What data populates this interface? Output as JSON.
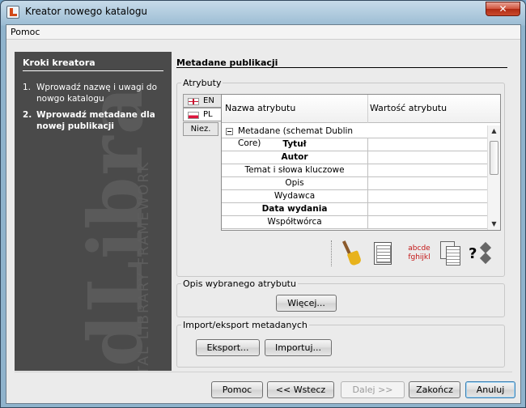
{
  "window": {
    "title": "Kreator nowego katalogu",
    "close_label": "✕"
  },
  "menu": {
    "items": [
      "Pomoc"
    ]
  },
  "steps": {
    "title": "Kroki kreatora",
    "items": [
      {
        "num": "1.",
        "label": "Wprowadź nazwę i uwagi do nowgo katalogu",
        "current": false
      },
      {
        "num": "2.",
        "label": "Wprowadź metadane dla nowej publikacji",
        "current": true
      }
    ],
    "watermark_logo": "dLibra",
    "watermark_text": "DIGITAL LIBRARY FRAMEWORK"
  },
  "section": {
    "title": "Metadane publikacji"
  },
  "attributes": {
    "group_label": "Atrybuty",
    "languages": [
      {
        "code": "EN",
        "selected": false
      },
      {
        "code": "PL",
        "selected": true
      }
    ],
    "niez_label": "Niez.",
    "columns": [
      "Nazwa atrybutu",
      "Wartość atrybutu"
    ],
    "root": "Metadane (schemat Dublin Core)",
    "rows": [
      {
        "name": "Tytuł",
        "value": "",
        "bold": true
      },
      {
        "name": "Autor",
        "value": "",
        "bold": true
      },
      {
        "name": "Temat i słowa kluczowe",
        "value": "",
        "bold": false
      },
      {
        "name": "Opis",
        "value": "",
        "bold": false
      },
      {
        "name": "Wydawca",
        "value": "",
        "bold": false
      },
      {
        "name": "Data wydania",
        "value": "",
        "bold": true
      },
      {
        "name": "Współtwórca",
        "value": "",
        "bold": false
      }
    ],
    "toolbar": {
      "abc_line1": "abcde",
      "abc_line2": "fghijkl",
      "help_q": "?"
    }
  },
  "description": {
    "group_label": "Opis wybranego atrybutu",
    "more_button": "Więcej..."
  },
  "import_export": {
    "group_label": "Import/eksport metadanych",
    "export_button": "Eksport...",
    "import_button": "Importuj..."
  },
  "footer": {
    "help": "Pomoc",
    "back": "<< Wstecz",
    "next": "Dalej >>",
    "finish": "Zakończ",
    "cancel": "Anuluj"
  },
  "colors": {
    "left_panel": "#4a4a4a",
    "window_bg": "#ebebeb",
    "close_red": "#c94a2d"
  }
}
